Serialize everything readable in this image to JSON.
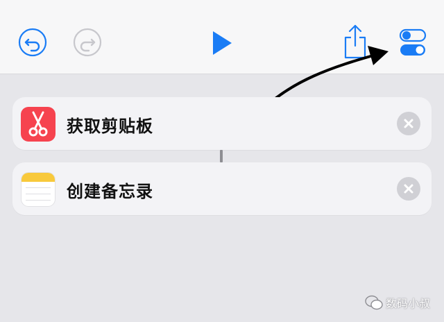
{
  "toolbar": {
    "undo_icon": "undo-icon",
    "redo_icon": "redo-icon",
    "play_icon": "play-icon",
    "share_icon": "share-icon",
    "settings_icon": "toggle-settings-icon"
  },
  "actions": [
    {
      "label": "获取剪贴板",
      "icon": "scissors-icon",
      "color": "#f6434f"
    },
    {
      "label": "创建备忘录",
      "icon": "notes-icon",
      "color": "#f8c93c"
    }
  ],
  "watermark": {
    "text": "数码小叔"
  },
  "colors": {
    "accent": "#1a7cf5",
    "disabled": "#c7c7cc",
    "remove": "#d0d0d5"
  }
}
